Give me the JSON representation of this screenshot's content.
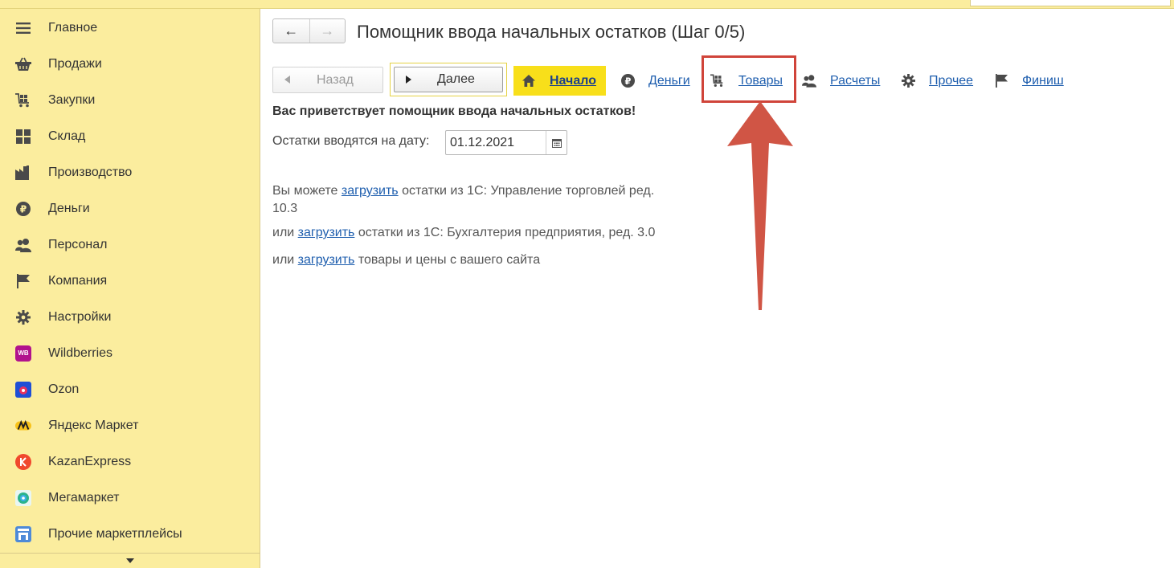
{
  "sidebar": {
    "items": [
      {
        "label": "Главное",
        "icon": "menu-icon"
      },
      {
        "label": "Продажи",
        "icon": "basket-icon"
      },
      {
        "label": "Закупки",
        "icon": "cart-icon"
      },
      {
        "label": "Склад",
        "icon": "warehouse-icon"
      },
      {
        "label": "Производство",
        "icon": "factory-icon"
      },
      {
        "label": "Деньги",
        "icon": "ruble-icon"
      },
      {
        "label": "Персонал",
        "icon": "people-icon"
      },
      {
        "label": "Компания",
        "icon": "flag-icon"
      },
      {
        "label": "Настройки",
        "icon": "gear-icon"
      },
      {
        "label": "Wildberries",
        "icon": "wildberries-icon"
      },
      {
        "label": "Ozon",
        "icon": "ozon-icon"
      },
      {
        "label": "Яндекс Маркет",
        "icon": "yandex-market-icon"
      },
      {
        "label": "KazanExpress",
        "icon": "kazanexpress-icon"
      },
      {
        "label": "Мегамаркет",
        "icon": "megamarket-icon"
      },
      {
        "label": "Прочие маркетплейсы",
        "icon": "marketplaces-icon"
      }
    ],
    "wb_badge": "WB"
  },
  "header": {
    "title": "Помощник ввода начальных остатков (Шаг 0/5)",
    "back_arrow": "←",
    "forward_arrow": "→"
  },
  "toolbar": {
    "back_label": "Назад",
    "next_label": "Далее"
  },
  "steps": [
    {
      "label": "Начало",
      "icon": "home-icon",
      "active": true
    },
    {
      "label": "Деньги",
      "icon": "ruble-icon",
      "active": false
    },
    {
      "label": "Товары",
      "icon": "cart-icon",
      "active": false
    },
    {
      "label": "Расчеты",
      "icon": "people-icon",
      "active": false
    },
    {
      "label": "Прочее",
      "icon": "gear-icon",
      "active": false
    },
    {
      "label": "Финиш",
      "icon": "flag-icon",
      "active": false
    }
  ],
  "content": {
    "welcome": "Вас приветствует помощник ввода начальных остатков!",
    "date_label": "Остатки вводятся на дату:",
    "date_value": "01.12.2021",
    "p1_pre": "Вы можете ",
    "p1_link": "загрузить",
    "p1_post": " остатки из 1С: Управление торговлей ред. 10.3",
    "p2_pre": "или ",
    "p2_link": "загрузить",
    "p2_post": " остатки из 1С: Бухгалтерия предприятия, ред. 3.0",
    "p3_pre": "или ",
    "p3_link": "загрузить",
    "p3_post": " товары и цены с вашего сайта"
  },
  "colors": {
    "sidebar_bg": "#fbed9e",
    "active_step_bg": "#f8df1a",
    "link": "#1e5eae",
    "annotation": "#d0443a"
  }
}
